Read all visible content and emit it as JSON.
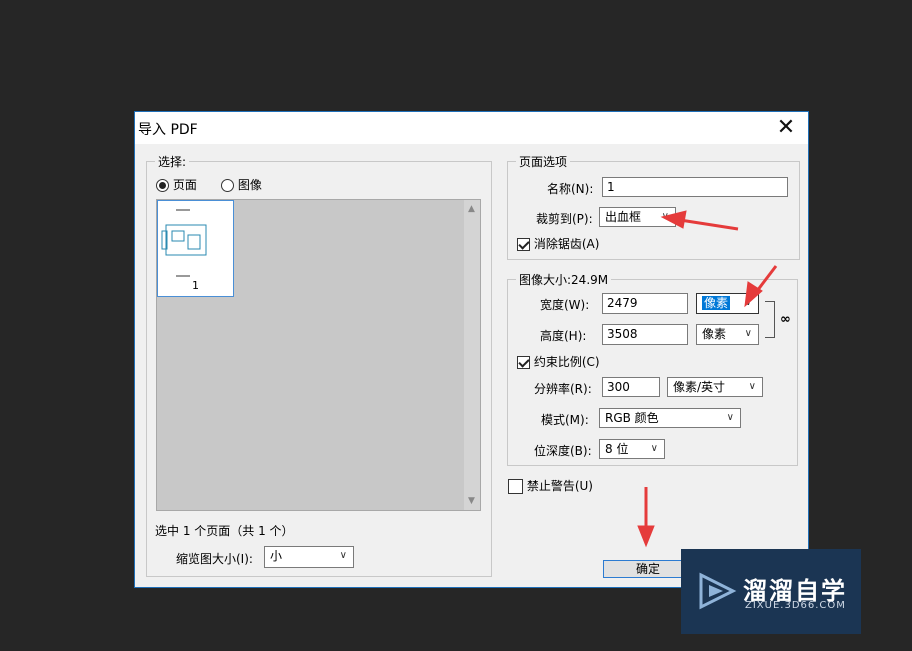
{
  "dialog": {
    "title": "导入 PDF",
    "close_glyph": "✕",
    "select_group": {
      "legend": "选择:",
      "option_page": "页面",
      "option_image": "图像",
      "page_number": "1",
      "selection_status": "选中 1 个页面（共 1 个）",
      "thumb_size_label": "缩览图大小(I):",
      "thumb_size_value": "小"
    },
    "page_options": {
      "legend": "页面选项",
      "name_label": "名称(N):",
      "name_value": "1",
      "crop_label": "裁剪到(P):",
      "crop_value": "出血框",
      "antialias_label": "消除锯齿(A)"
    },
    "image_size": {
      "legend": "图像大小:24.9M",
      "width_label": "宽度(W):",
      "width_value": "2479",
      "width_unit": "像素",
      "height_label": "高度(H):",
      "height_value": "3508",
      "height_unit": "像素",
      "constrain_label": "约束比例(C)",
      "resolution_label": "分辨率(R):",
      "resolution_value": "300",
      "resolution_unit": "像素/英寸",
      "mode_label": "模式(M):",
      "mode_value": "RGB 颜色",
      "depth_label": "位深度(B):",
      "depth_value": "8 位"
    },
    "suppress_warnings_label": "禁止警告(U)",
    "ok_label": "确定"
  },
  "watermark": {
    "brand_name": "溜溜自学",
    "brand_url": "ZIXUE.3D66.COM"
  },
  "colors": {
    "background": "#262626",
    "dialog": "#f0f0f0",
    "accent": "#0078d7",
    "annotation_arrow": "#e53b3b",
    "watermark_bg": "#1b3553"
  },
  "icons": [
    "close-icon",
    "chevron-down-icon",
    "chain-link-icon",
    "play-logo-icon"
  ]
}
